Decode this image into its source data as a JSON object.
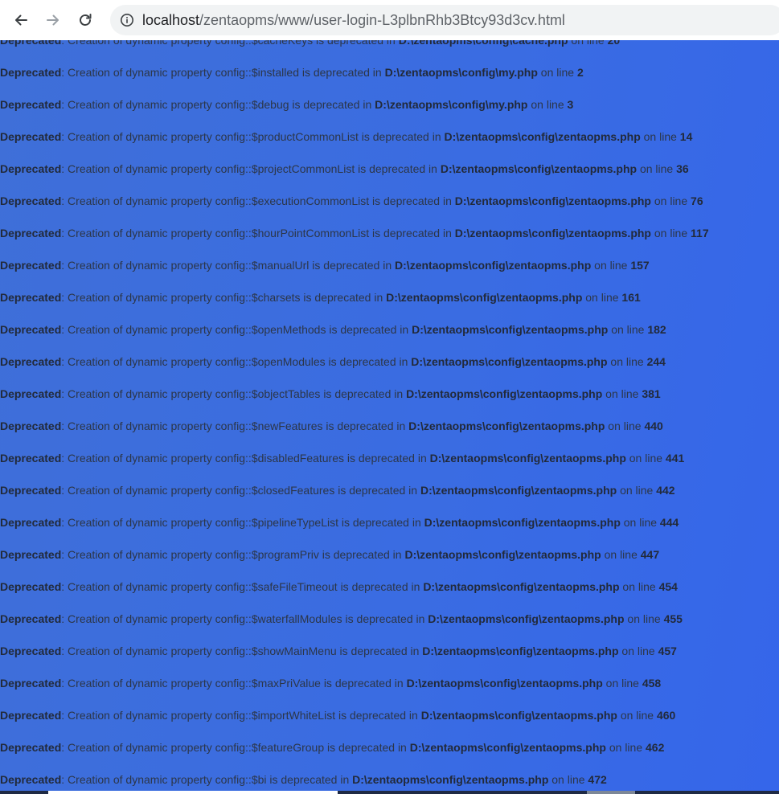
{
  "browser": {
    "url_host": "localhost",
    "url_path": "/zentaopms/www/user-login-L3plbnRhb3Btcy93d3cv.html",
    "icons": {
      "back": "back-arrow-icon",
      "forward": "forward-arrow-icon",
      "reload": "reload-icon",
      "info": "info-icon"
    }
  },
  "messages": [
    {
      "label": "Deprecated",
      "text": ": Creation of dynamic property config::$cacheKeys is deprecated in ",
      "file": "D:\\zentaopms\\config\\cache.php",
      "online": " on line ",
      "line": "20"
    },
    {
      "label": "Deprecated",
      "text": ": Creation of dynamic property config::$installed is deprecated in ",
      "file": "D:\\zentaopms\\config\\my.php",
      "online": " on line ",
      "line": "2"
    },
    {
      "label": "Deprecated",
      "text": ": Creation of dynamic property config::$debug is deprecated in ",
      "file": "D:\\zentaopms\\config\\my.php",
      "online": " on line ",
      "line": "3"
    },
    {
      "label": "Deprecated",
      "text": ": Creation of dynamic property config::$productCommonList is deprecated in ",
      "file": "D:\\zentaopms\\config\\zentaopms.php",
      "online": " on line ",
      "line": "14"
    },
    {
      "label": "Deprecated",
      "text": ": Creation of dynamic property config::$projectCommonList is deprecated in ",
      "file": "D:\\zentaopms\\config\\zentaopms.php",
      "online": " on line ",
      "line": "36"
    },
    {
      "label": "Deprecated",
      "text": ": Creation of dynamic property config::$executionCommonList is deprecated in ",
      "file": "D:\\zentaopms\\config\\zentaopms.php",
      "online": " on line ",
      "line": "76"
    },
    {
      "label": "Deprecated",
      "text": ": Creation of dynamic property config::$hourPointCommonList is deprecated in ",
      "file": "D:\\zentaopms\\config\\zentaopms.php",
      "online": " on line ",
      "line": "117"
    },
    {
      "label": "Deprecated",
      "text": ": Creation of dynamic property config::$manualUrl is deprecated in ",
      "file": "D:\\zentaopms\\config\\zentaopms.php",
      "online": " on line ",
      "line": "157"
    },
    {
      "label": "Deprecated",
      "text": ": Creation of dynamic property config::$charsets is deprecated in ",
      "file": "D:\\zentaopms\\config\\zentaopms.php",
      "online": " on line ",
      "line": "161"
    },
    {
      "label": "Deprecated",
      "text": ": Creation of dynamic property config::$openMethods is deprecated in ",
      "file": "D:\\zentaopms\\config\\zentaopms.php",
      "online": " on line ",
      "line": "182"
    },
    {
      "label": "Deprecated",
      "text": ": Creation of dynamic property config::$openModules is deprecated in ",
      "file": "D:\\zentaopms\\config\\zentaopms.php",
      "online": " on line ",
      "line": "244"
    },
    {
      "label": "Deprecated",
      "text": ": Creation of dynamic property config::$objectTables is deprecated in ",
      "file": "D:\\zentaopms\\config\\zentaopms.php",
      "online": " on line ",
      "line": "381"
    },
    {
      "label": "Deprecated",
      "text": ": Creation of dynamic property config::$newFeatures is deprecated in ",
      "file": "D:\\zentaopms\\config\\zentaopms.php",
      "online": " on line ",
      "line": "440"
    },
    {
      "label": "Deprecated",
      "text": ": Creation of dynamic property config::$disabledFeatures is deprecated in ",
      "file": "D:\\zentaopms\\config\\zentaopms.php",
      "online": " on line ",
      "line": "441"
    },
    {
      "label": "Deprecated",
      "text": ": Creation of dynamic property config::$closedFeatures is deprecated in ",
      "file": "D:\\zentaopms\\config\\zentaopms.php",
      "online": " on line ",
      "line": "442"
    },
    {
      "label": "Deprecated",
      "text": ": Creation of dynamic property config::$pipelineTypeList is deprecated in ",
      "file": "D:\\zentaopms\\config\\zentaopms.php",
      "online": " on line ",
      "line": "444"
    },
    {
      "label": "Deprecated",
      "text": ": Creation of dynamic property config::$programPriv is deprecated in ",
      "file": "D:\\zentaopms\\config\\zentaopms.php",
      "online": " on line ",
      "line": "447"
    },
    {
      "label": "Deprecated",
      "text": ": Creation of dynamic property config::$safeFileTimeout is deprecated in ",
      "file": "D:\\zentaopms\\config\\zentaopms.php",
      "online": " on line ",
      "line": "454"
    },
    {
      "label": "Deprecated",
      "text": ": Creation of dynamic property config::$waterfallModules is deprecated in ",
      "file": "D:\\zentaopms\\config\\zentaopms.php",
      "online": " on line ",
      "line": "455"
    },
    {
      "label": "Deprecated",
      "text": ": Creation of dynamic property config::$showMainMenu is deprecated in ",
      "file": "D:\\zentaopms\\config\\zentaopms.php",
      "online": " on line ",
      "line": "457"
    },
    {
      "label": "Deprecated",
      "text": ": Creation of dynamic property config::$maxPriValue is deprecated in ",
      "file": "D:\\zentaopms\\config\\zentaopms.php",
      "online": " on line ",
      "line": "458"
    },
    {
      "label": "Deprecated",
      "text": ": Creation of dynamic property config::$importWhiteList is deprecated in ",
      "file": "D:\\zentaopms\\config\\zentaopms.php",
      "online": " on line ",
      "line": "460"
    },
    {
      "label": "Deprecated",
      "text": ": Creation of dynamic property config::$featureGroup is deprecated in ",
      "file": "D:\\zentaopms\\config\\zentaopms.php",
      "online": " on line ",
      "line": "462"
    },
    {
      "label": "Deprecated",
      "text": ": Creation of dynamic property config::$bi is deprecated in ",
      "file": "D:\\zentaopms\\config\\zentaopms.php",
      "online": " on line ",
      "line": "472"
    }
  ]
}
